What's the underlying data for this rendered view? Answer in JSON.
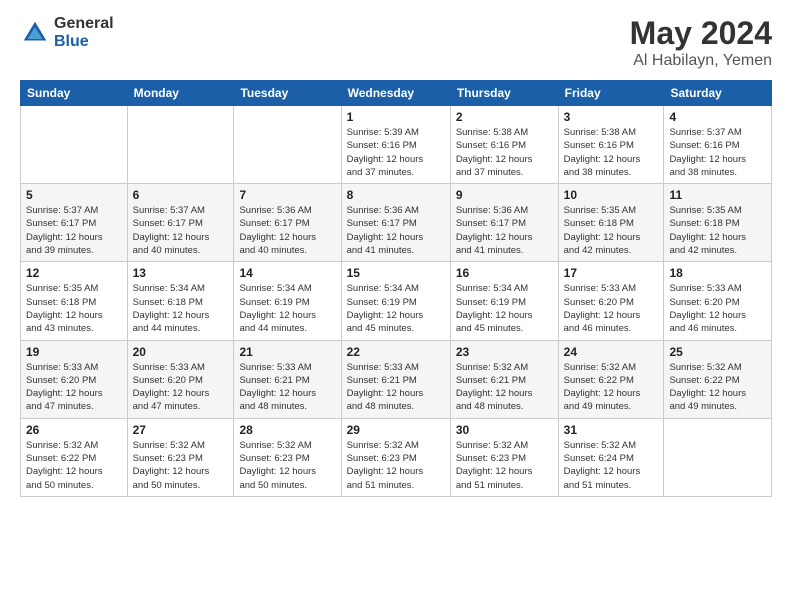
{
  "header": {
    "logo_general": "General",
    "logo_blue": "Blue",
    "title": "May 2024",
    "location": "Al Habilayn, Yemen"
  },
  "days_of_week": [
    "Sunday",
    "Monday",
    "Tuesday",
    "Wednesday",
    "Thursday",
    "Friday",
    "Saturday"
  ],
  "weeks": [
    [
      {
        "day": "",
        "info": ""
      },
      {
        "day": "",
        "info": ""
      },
      {
        "day": "",
        "info": ""
      },
      {
        "day": "1",
        "info": "Sunrise: 5:39 AM\nSunset: 6:16 PM\nDaylight: 12 hours\nand 37 minutes."
      },
      {
        "day": "2",
        "info": "Sunrise: 5:38 AM\nSunset: 6:16 PM\nDaylight: 12 hours\nand 37 minutes."
      },
      {
        "day": "3",
        "info": "Sunrise: 5:38 AM\nSunset: 6:16 PM\nDaylight: 12 hours\nand 38 minutes."
      },
      {
        "day": "4",
        "info": "Sunrise: 5:37 AM\nSunset: 6:16 PM\nDaylight: 12 hours\nand 38 minutes."
      }
    ],
    [
      {
        "day": "5",
        "info": "Sunrise: 5:37 AM\nSunset: 6:17 PM\nDaylight: 12 hours\nand 39 minutes."
      },
      {
        "day": "6",
        "info": "Sunrise: 5:37 AM\nSunset: 6:17 PM\nDaylight: 12 hours\nand 40 minutes."
      },
      {
        "day": "7",
        "info": "Sunrise: 5:36 AM\nSunset: 6:17 PM\nDaylight: 12 hours\nand 40 minutes."
      },
      {
        "day": "8",
        "info": "Sunrise: 5:36 AM\nSunset: 6:17 PM\nDaylight: 12 hours\nand 41 minutes."
      },
      {
        "day": "9",
        "info": "Sunrise: 5:36 AM\nSunset: 6:17 PM\nDaylight: 12 hours\nand 41 minutes."
      },
      {
        "day": "10",
        "info": "Sunrise: 5:35 AM\nSunset: 6:18 PM\nDaylight: 12 hours\nand 42 minutes."
      },
      {
        "day": "11",
        "info": "Sunrise: 5:35 AM\nSunset: 6:18 PM\nDaylight: 12 hours\nand 42 minutes."
      }
    ],
    [
      {
        "day": "12",
        "info": "Sunrise: 5:35 AM\nSunset: 6:18 PM\nDaylight: 12 hours\nand 43 minutes."
      },
      {
        "day": "13",
        "info": "Sunrise: 5:34 AM\nSunset: 6:18 PM\nDaylight: 12 hours\nand 44 minutes."
      },
      {
        "day": "14",
        "info": "Sunrise: 5:34 AM\nSunset: 6:19 PM\nDaylight: 12 hours\nand 44 minutes."
      },
      {
        "day": "15",
        "info": "Sunrise: 5:34 AM\nSunset: 6:19 PM\nDaylight: 12 hours\nand 45 minutes."
      },
      {
        "day": "16",
        "info": "Sunrise: 5:34 AM\nSunset: 6:19 PM\nDaylight: 12 hours\nand 45 minutes."
      },
      {
        "day": "17",
        "info": "Sunrise: 5:33 AM\nSunset: 6:20 PM\nDaylight: 12 hours\nand 46 minutes."
      },
      {
        "day": "18",
        "info": "Sunrise: 5:33 AM\nSunset: 6:20 PM\nDaylight: 12 hours\nand 46 minutes."
      }
    ],
    [
      {
        "day": "19",
        "info": "Sunrise: 5:33 AM\nSunset: 6:20 PM\nDaylight: 12 hours\nand 47 minutes."
      },
      {
        "day": "20",
        "info": "Sunrise: 5:33 AM\nSunset: 6:20 PM\nDaylight: 12 hours\nand 47 minutes."
      },
      {
        "day": "21",
        "info": "Sunrise: 5:33 AM\nSunset: 6:21 PM\nDaylight: 12 hours\nand 48 minutes."
      },
      {
        "day": "22",
        "info": "Sunrise: 5:33 AM\nSunset: 6:21 PM\nDaylight: 12 hours\nand 48 minutes."
      },
      {
        "day": "23",
        "info": "Sunrise: 5:32 AM\nSunset: 6:21 PM\nDaylight: 12 hours\nand 48 minutes."
      },
      {
        "day": "24",
        "info": "Sunrise: 5:32 AM\nSunset: 6:22 PM\nDaylight: 12 hours\nand 49 minutes."
      },
      {
        "day": "25",
        "info": "Sunrise: 5:32 AM\nSunset: 6:22 PM\nDaylight: 12 hours\nand 49 minutes."
      }
    ],
    [
      {
        "day": "26",
        "info": "Sunrise: 5:32 AM\nSunset: 6:22 PM\nDaylight: 12 hours\nand 50 minutes."
      },
      {
        "day": "27",
        "info": "Sunrise: 5:32 AM\nSunset: 6:23 PM\nDaylight: 12 hours\nand 50 minutes."
      },
      {
        "day": "28",
        "info": "Sunrise: 5:32 AM\nSunset: 6:23 PM\nDaylight: 12 hours\nand 50 minutes."
      },
      {
        "day": "29",
        "info": "Sunrise: 5:32 AM\nSunset: 6:23 PM\nDaylight: 12 hours\nand 51 minutes."
      },
      {
        "day": "30",
        "info": "Sunrise: 5:32 AM\nSunset: 6:23 PM\nDaylight: 12 hours\nand 51 minutes."
      },
      {
        "day": "31",
        "info": "Sunrise: 5:32 AM\nSunset: 6:24 PM\nDaylight: 12 hours\nand 51 minutes."
      },
      {
        "day": "",
        "info": ""
      }
    ]
  ]
}
